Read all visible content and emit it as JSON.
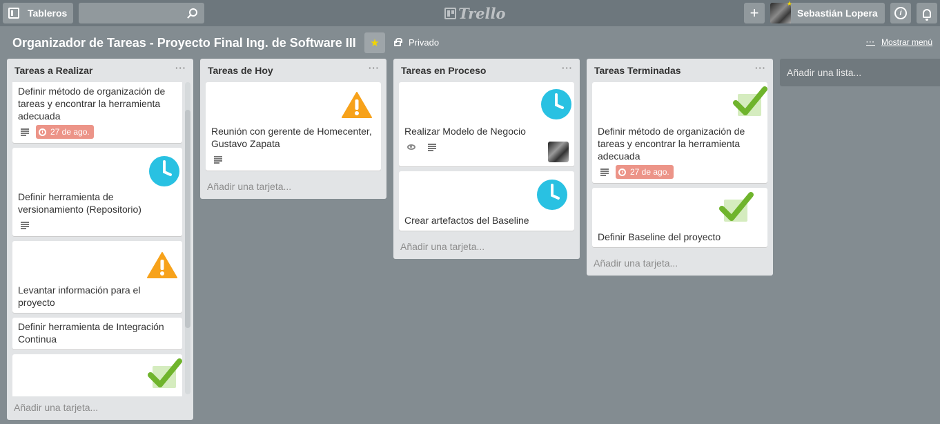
{
  "header": {
    "boards_label": "Tableros",
    "search_placeholder": "",
    "logo_text": "Trello",
    "add_label": "+",
    "member_name": "Sebastián Lopera",
    "info_label": "i"
  },
  "board": {
    "title": "Organizador de Tareas - Proyecto Final Ing. de Software III",
    "star_icon": "★",
    "privacy_label": "Privado",
    "show_menu_label": "Mostrar menú",
    "show_menu_dots": "···"
  },
  "lists": [
    {
      "title": "Tareas a Realizar",
      "menu": "···",
      "add_card": "Añadir una tarjeta...",
      "cards": [
        {
          "title": "Definir método de organización de tareas y encontrar la herramienta adecuada",
          "due": "27 de ago.",
          "sticker": "",
          "description": true
        },
        {
          "title": "Definir herramienta de versionamiento (Repositorio)",
          "sticker": "clock-sticker",
          "description": true
        },
        {
          "title": "Levantar información para el proyecto",
          "sticker": "warning-sticker"
        },
        {
          "title": "Definir herramienta de Integración Continua",
          "sticker": ""
        },
        {
          "title": "",
          "sticker": "check-sticker"
        }
      ]
    },
    {
      "title": "Tareas de Hoy",
      "menu": "···",
      "add_card": "Añadir una tarjeta...",
      "cards": [
        {
          "title": "Reunión con gerente de Homecenter, Gustavo Zapata",
          "sticker": "warning-sticker",
          "description": true
        }
      ]
    },
    {
      "title": "Tareas en Proceso",
      "menu": "···",
      "add_card": "Añadir una tarjeta...",
      "cards": [
        {
          "title": "Realizar Modelo de Negocio",
          "sticker": "clock-sticker",
          "watch": true,
          "description": true,
          "member": true
        },
        {
          "title": "Crear artefactos del Baseline",
          "sticker": "clock-sticker"
        }
      ]
    },
    {
      "title": "Tareas Terminadas",
      "menu": "···",
      "add_card": "Añadir una tarjeta...",
      "cards": [
        {
          "title": "Definir método de organización de tareas y encontrar la herramienta adecuada",
          "sticker": "check-sticker",
          "description": true,
          "due": "27 de ago."
        },
        {
          "title": "Definir Baseline del proyecto",
          "sticker": "check-sticker"
        }
      ]
    }
  ],
  "add_list_label": "Añadir una lista...",
  "colors": {
    "board_bg": "#838c91",
    "header_bg": "#6d777d",
    "list_bg": "#e2e4e6",
    "due_badge": "#ec9488",
    "clock_sticker": "#29c1e2",
    "warning_sticker": "#f7a21b",
    "check_sticker": "#6fb42c"
  }
}
